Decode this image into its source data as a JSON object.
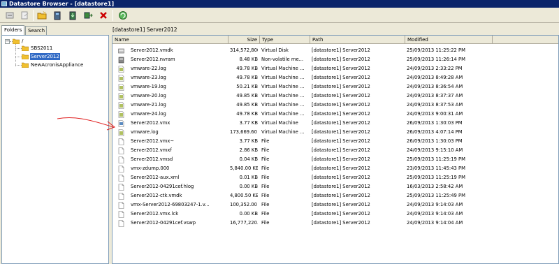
{
  "window": {
    "title": "Datastore Browser - [datastore1]"
  },
  "toolbar": {
    "buttons": [
      {
        "name": "refresh-icon"
      },
      {
        "name": "browse-icon"
      },
      {
        "name": "new-folder-icon"
      },
      {
        "name": "upload-icon"
      },
      {
        "name": "download-icon"
      },
      {
        "name": "register-vm-icon"
      },
      {
        "name": "delete-icon"
      },
      {
        "name": "inventory-icon"
      }
    ],
    "colors": {
      "delete": "#cc0000",
      "folder": "#f0c030",
      "accent": "#3a9a3a"
    }
  },
  "left": {
    "tabs": [
      {
        "label": "Folders"
      },
      {
        "label": "Search"
      }
    ],
    "tree": {
      "root": "/",
      "children": [
        {
          "label": "SBS2011"
        },
        {
          "label": "Server2012"
        },
        {
          "label": "NewAcronisAppliance"
        }
      ],
      "selected_index": 1
    }
  },
  "main": {
    "path": "[datastore1] Server2012",
    "columns": {
      "name": "Name",
      "size": "Size",
      "type": "Type",
      "path": "Path",
      "modified": "Modified"
    },
    "rows": [
      {
        "icon": "disk-icon",
        "name": "Server2012.vmdk",
        "size": "314,572,800.00 ...",
        "type": "Virtual Disk",
        "path": "[datastore1] Server2012",
        "modified": "25/09/2013 11:25:22 PM"
      },
      {
        "icon": "nvram-icon",
        "name": "Server2012.nvram",
        "size": "8.48 KB",
        "type": "Non-volatile me...",
        "path": "[datastore1] Server2012",
        "modified": "25/09/2013 11:26:14 PM"
      },
      {
        "icon": "log-icon",
        "name": "vmware-22.log",
        "size": "49.78 KB",
        "type": "Virtual Machine ...",
        "path": "[datastore1] Server2012",
        "modified": "24/09/2013 2:33:22 PM"
      },
      {
        "icon": "log-icon",
        "name": "vmware-23.log",
        "size": "49.78 KB",
        "type": "Virtual Machine ...",
        "path": "[datastore1] Server2012",
        "modified": "24/09/2013 8:49:28 AM"
      },
      {
        "icon": "log-icon",
        "name": "vmware-19.log",
        "size": "50.21 KB",
        "type": "Virtual Machine ...",
        "path": "[datastore1] Server2012",
        "modified": "24/09/2013 8:36:54 AM"
      },
      {
        "icon": "log-icon",
        "name": "vmware-20.log",
        "size": "49.85 KB",
        "type": "Virtual Machine ...",
        "path": "[datastore1] Server2012",
        "modified": "24/09/2013 8:37:37 AM"
      },
      {
        "icon": "log-icon",
        "name": "vmware-21.log",
        "size": "49.85 KB",
        "type": "Virtual Machine ...",
        "path": "[datastore1] Server2012",
        "modified": "24/09/2013 8:37:53 AM"
      },
      {
        "icon": "log-icon",
        "name": "vmware-24.log",
        "size": "49.78 KB",
        "type": "Virtual Machine ...",
        "path": "[datastore1] Server2012",
        "modified": "24/09/2013 9:00:31 AM"
      },
      {
        "icon": "vmx-icon",
        "name": "Server2012.vmx",
        "size": "3.77 KB",
        "type": "Virtual Machine",
        "path": "[datastore1] Server2012",
        "modified": "26/09/2013 1:30:03 PM"
      },
      {
        "icon": "log-icon",
        "name": "vmware.log",
        "size": "173,669.60 KB",
        "type": "Virtual Machine ...",
        "path": "[datastore1] Server2012",
        "modified": "26/09/2013 4:07:14 PM"
      },
      {
        "icon": "file-icon",
        "name": "Server2012.vmx~",
        "size": "3.77 KB",
        "type": "File",
        "path": "[datastore1] Server2012",
        "modified": "26/09/2013 1:30:03 PM"
      },
      {
        "icon": "file-icon",
        "name": "Server2012.vmxf",
        "size": "2.86 KB",
        "type": "File",
        "path": "[datastore1] Server2012",
        "modified": "24/09/2013 9:15:10 AM"
      },
      {
        "icon": "file-icon",
        "name": "Server2012.vmsd",
        "size": "0.04 KB",
        "type": "File",
        "path": "[datastore1] Server2012",
        "modified": "25/09/2013 11:25:19 PM"
      },
      {
        "icon": "file-icon",
        "name": "vmx-zdump.000",
        "size": "5,840.00 KB",
        "type": "File",
        "path": "[datastore1] Server2012",
        "modified": "23/09/2013 11:45:43 PM"
      },
      {
        "icon": "file-icon",
        "name": "Server2012-aux.xml",
        "size": "0.01 KB",
        "type": "File",
        "path": "[datastore1] Server2012",
        "modified": "25/09/2013 11:25:19 PM"
      },
      {
        "icon": "file-icon",
        "name": "Server2012-04291cef.hlog",
        "size": "0.00 KB",
        "type": "File",
        "path": "[datastore1] Server2012",
        "modified": "16/03/2013 2:58:42 AM"
      },
      {
        "icon": "file-icon",
        "name": "Server2012-ctk.vmdk",
        "size": "4,800.50 KB",
        "type": "File",
        "path": "[datastore1] Server2012",
        "modified": "25/09/2013 11:25:49 PM"
      },
      {
        "icon": "file-icon",
        "name": "vmx-Server2012-69803247-1.v...",
        "size": "100,352.00 KB",
        "type": "File",
        "path": "[datastore1] Server2012",
        "modified": "24/09/2013 9:14:03 AM"
      },
      {
        "icon": "file-icon",
        "name": "Server2012.vmx.lck",
        "size": "0.00 KB",
        "type": "File",
        "path": "[datastore1] Server2012",
        "modified": "24/09/2013 9:14:03 AM"
      },
      {
        "icon": "file-icon",
        "name": "Server2012-04291cef.vswp",
        "size": "16,777,220.00 K",
        "type": "File",
        "path": "[datastore1] Server2012",
        "modified": "24/09/2013 9:14:04 AM"
      }
    ]
  },
  "annotation": {
    "color": "#e02020"
  }
}
